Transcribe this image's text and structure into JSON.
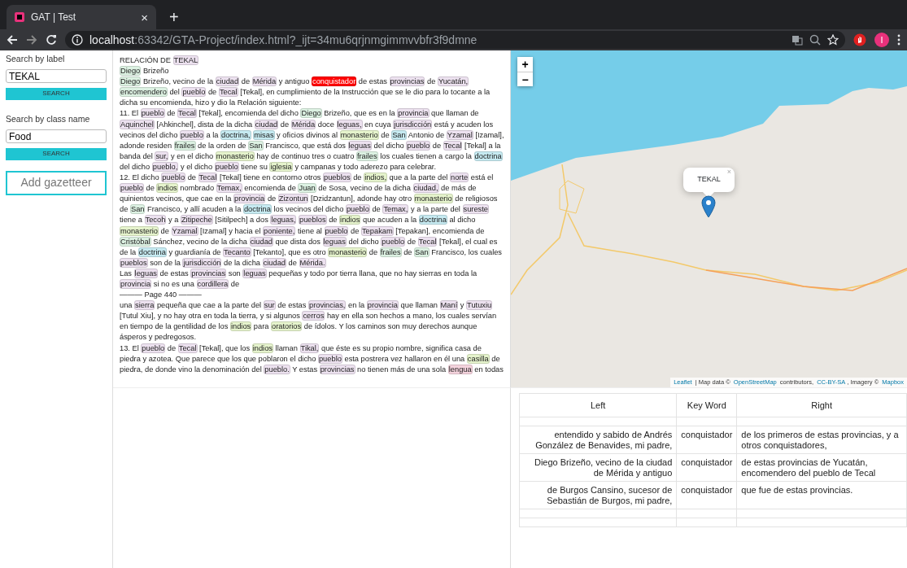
{
  "browser": {
    "tab_title": "GAT | Test",
    "tab_close": "×",
    "new_tab": "+",
    "url_host": "localhost",
    "url_rest": ":63342/GTA-Project/index.html?_ijt=34mu6qrjnmgimmvvbfr3f9dmne",
    "profile_initial": "I"
  },
  "sidebar": {
    "searches": [
      {
        "label": "Search by label",
        "value": "TEKAL",
        "button": "SEARCH"
      },
      {
        "label": "Search by class name",
        "value": "Food",
        "button": "SEARCH"
      }
    ],
    "add_button": "Add gazetteer"
  },
  "document": {
    "paragraphs": [
      [
        "RELACIÓN DE ",
        {
          "text": "TEKAL",
          "color": "#ece1ef"
        }
      ],
      [
        {
          "text": "Diego",
          "color": "#dcf1e2"
        },
        " Brizeño"
      ],
      [
        {
          "text": "Diego",
          "color": "#dcf1e2"
        },
        " Brizeño, vecino de la ",
        {
          "text": "ciudad",
          "color": "#ece1ef"
        },
        " de ",
        {
          "text": "Mérida",
          "color": "#ece1ef"
        },
        " y antiguo ",
        {
          "text": "conquistador",
          "color": "#ff0000"
        },
        " de estas ",
        {
          "text": "provincias",
          "color": "#ece1ef"
        },
        " de ",
        {
          "text": "Yucatán,",
          "color": "#ece1ef"
        },
        {
          "text": "encomendero",
          "color": "#dcf1e2"
        },
        " del ",
        {
          "text": "pueblo",
          "color": "#ece1ef"
        },
        " de ",
        {
          "text": "Tecal",
          "color": "#ece1ef"
        },
        " [Tekal], en cumplimiento de la Instrucción que se le dio para lo tocante a la dicha su encomienda, hizo y dio la Relación siguiente:"
      ],
      [
        "11. El ",
        {
          "text": "pueblo",
          "color": "#ece1ef"
        },
        " de ",
        {
          "text": "Tecal",
          "color": "#ece1ef"
        },
        " [Tekal], encomienda del dicho ",
        {
          "text": "Diego",
          "color": "#dcf1e2"
        },
        " Brizeño, que es en la ",
        {
          "text": "provincia",
          "color": "#ece1ef"
        },
        " que llaman de ",
        {
          "text": "Aquinchel",
          "color": "#ece1ef"
        },
        " [Ahkinchel], dista de la dicha ",
        {
          "text": "ciudad",
          "color": "#ece1ef"
        },
        " de ",
        {
          "text": "Mérida",
          "color": "#ece1ef"
        },
        " doce ",
        {
          "text": "leguas,",
          "color": "#ece1ef"
        },
        " en cuya ",
        {
          "text": "jurisdicción",
          "color": "#ece1ef"
        },
        " está y acuden los vecinos del dicho ",
        {
          "text": "pueblo",
          "color": "#ece1ef"
        },
        " a la ",
        {
          "text": "doctrina,",
          "color": "#c6eaf1"
        },
        {
          "text": "misas",
          "color": "#c6eaf1"
        },
        " y oficios divinos al ",
        {
          "text": "monasterio",
          "color": "#e5f3cc"
        },
        " de ",
        {
          "text": "San",
          "color": "#c6eaf1"
        },
        " Antonio de ",
        {
          "text": "Yzamal",
          "color": "#ece1ef"
        },
        " [Izamal], adonde residen ",
        {
          "text": "frailes",
          "color": "#dcf1e2"
        },
        " de la orden de ",
        {
          "text": "San",
          "color": "#dcf1e2"
        },
        " Francisco, que está dos ",
        {
          "text": "leguas",
          "color": "#ece1ef"
        },
        " del dicho ",
        {
          "text": "pueblo",
          "color": "#ece1ef"
        },
        " de ",
        {
          "text": "Tecal",
          "color": "#ece1ef"
        },
        " [Tekal] a la banda del ",
        {
          "text": "sur,",
          "color": "#ece1ef"
        },
        " y en el dicho ",
        {
          "text": "monasterio",
          "color": "#e5f3cc"
        },
        " hay de continuo tres o cuatro ",
        {
          "text": "frailes",
          "color": "#dcf1e2"
        },
        " los cuales tienen a cargo la ",
        {
          "text": "doctrina",
          "color": "#c6eaf1"
        },
        " del dicho ",
        {
          "text": "pueblo,",
          "color": "#ece1ef"
        },
        " y el dicho ",
        {
          "text": "pueblo",
          "color": "#ece1ef"
        },
        " tiene su ",
        {
          "text": "iglesia",
          "color": "#e5f3cc"
        },
        " y campanas y todo aderezo para celebrar."
      ],
      [
        "12. El dicho ",
        {
          "text": "pueblo",
          "color": "#ece1ef"
        },
        " de ",
        {
          "text": "Tecal",
          "color": "#ece1ef"
        },
        " [Tekal] tiene en contorno otros ",
        {
          "text": "pueblos",
          "color": "#ece1ef"
        },
        " de ",
        {
          "text": "indios,",
          "color": "#e5f3cc"
        },
        " que a la parte del ",
        {
          "text": "norte",
          "color": "#ece1ef"
        },
        " está el ",
        {
          "text": "pueblo",
          "color": "#ece1ef"
        },
        " de ",
        {
          "text": "indios",
          "color": "#e5f3cc"
        },
        " nombrado ",
        {
          "text": "Temax,",
          "color": "#ece1ef"
        },
        " encomienda de ",
        {
          "text": "Juan",
          "color": "#dcf1e2"
        },
        " de Sosa, vecino de la dicha ",
        {
          "text": "ciudad,",
          "color": "#ece1ef"
        },
        " de más de quinientos vecinos, que cae en la ",
        {
          "text": "provincia",
          "color": "#ece1ef"
        },
        " de ",
        {
          "text": "Zizontun",
          "color": "#ece1ef"
        },
        " [Dzidzantun], adonde hay otro ",
        {
          "text": "monasterio",
          "color": "#e5f3cc"
        },
        " de religiosos de ",
        {
          "text": "San",
          "color": "#dcf1e2"
        },
        " Francisco, y allí acuden a la ",
        {
          "text": "doctrina",
          "color": "#c6eaf1"
        },
        " los vecinos del dicho ",
        {
          "text": "pueblo",
          "color": "#ece1ef"
        },
        " de ",
        {
          "text": "Temax,",
          "color": "#ece1ef"
        },
        " y a la parte del ",
        {
          "text": "sureste",
          "color": "#ece1ef"
        },
        " tiene a ",
        {
          "text": "Tecoh",
          "color": "#ece1ef"
        },
        " y a ",
        {
          "text": "Zitipeche",
          "color": "#ece1ef"
        },
        " [Sitilpech] a dos ",
        {
          "text": "leguas,",
          "color": "#ece1ef"
        },
        {
          "text": "pueblos",
          "color": "#ece1ef"
        },
        " de ",
        {
          "text": "indios",
          "color": "#e5f3cc"
        },
        " que acuden a la ",
        {
          "text": "doctrina",
          "color": "#c6eaf1"
        },
        " al dicho ",
        {
          "text": "monasterio",
          "color": "#e5f3cc"
        },
        " de ",
        {
          "text": "Yzamal",
          "color": "#ece1ef"
        },
        " [Izamal] y hacia el ",
        {
          "text": "poniente,",
          "color": "#ece1ef"
        },
        " tiene al ",
        {
          "text": "pueblo",
          "color": "#ece1ef"
        },
        " de ",
        {
          "text": "Tepakam",
          "color": "#ece1ef"
        },
        " [Tepakan], encomienda de ",
        {
          "text": "Cristóbal",
          "color": "#dcf1e2"
        },
        " Sánchez, vecino de la dicha ",
        {
          "text": "ciudad",
          "color": "#ece1ef"
        },
        " que dista dos ",
        {
          "text": "leguas",
          "color": "#ece1ef"
        },
        " del dicho ",
        {
          "text": "pueblo",
          "color": "#ece1ef"
        },
        " de ",
        {
          "text": "Tecal",
          "color": "#ece1ef"
        },
        " [Tekal], el cual es de la ",
        {
          "text": "doctrina",
          "color": "#c6eaf1"
        },
        " y guardianía de ",
        {
          "text": "Tecanto",
          "color": "#ece1ef"
        },
        " [Tekanto], que es otro ",
        {
          "text": "monasterio",
          "color": "#e5f3cc"
        },
        " de ",
        {
          "text": "frailes",
          "color": "#dcf1e2"
        },
        " de ",
        {
          "text": "San",
          "color": "#dcf1e2"
        },
        " Francisco, los cuales ",
        {
          "text": "pueblos",
          "color": "#ece1ef"
        },
        " son de la ",
        {
          "text": "jurisdicción",
          "color": "#ece1ef"
        },
        " de la dicha ",
        {
          "text": "ciudad",
          "color": "#ece1ef"
        },
        " de ",
        {
          "text": "Mérida.",
          "color": "#ece1ef"
        }
      ],
      [
        "Las ",
        {
          "text": "leguas",
          "color": "#ece1ef"
        },
        " de estas ",
        {
          "text": "provincias",
          "color": "#ece1ef"
        },
        " son ",
        {
          "text": "leguas",
          "color": "#ece1ef"
        },
        " pequeñas y todo por tierra llana, que no hay sierras en toda la ",
        {
          "text": "provincia",
          "color": "#ece1ef"
        },
        " si no es una ",
        {
          "text": "cordillera",
          "color": "#ece1ef"
        },
        " de"
      ],
      [
        "——— Page 440 ———"
      ],
      [
        "una ",
        {
          "text": "sierra",
          "color": "#ece1ef"
        },
        " pequeña que cae a la parte del ",
        {
          "text": "sur",
          "color": "#ece1ef"
        },
        " de estas ",
        {
          "text": "provincias,",
          "color": "#ece1ef"
        },
        " en la ",
        {
          "text": "provincia",
          "color": "#ece1ef"
        },
        " que llaman ",
        {
          "text": "Maní",
          "color": "#ece1ef"
        },
        " y ",
        {
          "text": "Tutuxiu",
          "color": "#ece1ef"
        },
        " [Tutul Xiu], y no hay otra en toda la tierra, y si algunos ",
        {
          "text": "cerros",
          "color": "#ece1ef"
        },
        " hay en ella son hechos a mano, los cuales servían en tiempo de la gentilidad de los ",
        {
          "text": "indios",
          "color": "#e5f3cc"
        },
        " para ",
        {
          "text": "oratorios",
          "color": "#e5f3cc"
        },
        " de ídolos. Y los caminos son muy derechos aunque ásperos y pedregosos."
      ],
      [
        "13. El ",
        {
          "text": "pueblo",
          "color": "#ece1ef"
        },
        " de ",
        {
          "text": "Tecal",
          "color": "#ece1ef"
        },
        " [Tekal], que los ",
        {
          "text": "indios",
          "color": "#e5f3cc"
        },
        " llaman ",
        {
          "text": "Tikal,",
          "color": "#ece1ef"
        },
        " que éste es su propio nombre, significa casa de piedra y azotea. Que parece que los que poblaron el dicho ",
        {
          "text": "pueblo",
          "color": "#ece1ef"
        },
        " esta postrera vez hallaron en él una ",
        {
          "text": "casilla",
          "color": "#e5f3cc"
        },
        " de piedra, de donde vino la denominación del ",
        {
          "text": "pueblo.",
          "color": "#ece1ef"
        },
        " Y estas ",
        {
          "text": "provincias",
          "color": "#ece1ef"
        },
        " no tienen más de una sola ",
        {
          "text": "lengua",
          "color": "#f4d3dd"
        },
        " en todas"
      ]
    ]
  },
  "map": {
    "zoom_in": "+",
    "zoom_out": "−",
    "popup": {
      "text": "TEKAL",
      "close": "×"
    },
    "attribution": [
      {
        "text": "Leaflet",
        "kind": "link"
      },
      {
        "text": " | Map data © ",
        "kind": "text"
      },
      {
        "text": "OpenStreetMap",
        "kind": "link"
      },
      {
        "text": " contributors, ",
        "kind": "text"
      },
      {
        "text": "CC-BY-SA",
        "kind": "link"
      },
      {
        "text": ", Imagery © ",
        "kind": "text"
      },
      {
        "text": "Mapbox",
        "kind": "link"
      }
    ]
  },
  "kwic_table": {
    "columns": [
      "Left",
      "Key Word",
      "Right"
    ],
    "rows": [
      {},
      {
        "left": "entendido y sabido de Andrés González de Benavides, mi padre,",
        "key_word": "conquistador",
        "right": "de los primeros de estas provincias, y a otros conquistadores,"
      },
      {
        "left": "Diego Brizeño, vecino de la ciudad de Mérida y antiguo",
        "key_word": "conquistador",
        "right": "de estas provincias de Yucatán, encomendero del pueblo de Tecal"
      },
      {
        "left": "de Burgos Cansino, sucesor de Sebastián de Burgos, mi padre,",
        "key_word": "conquistador",
        "right": "que fue de estas provincias."
      },
      {},
      {}
    ]
  }
}
